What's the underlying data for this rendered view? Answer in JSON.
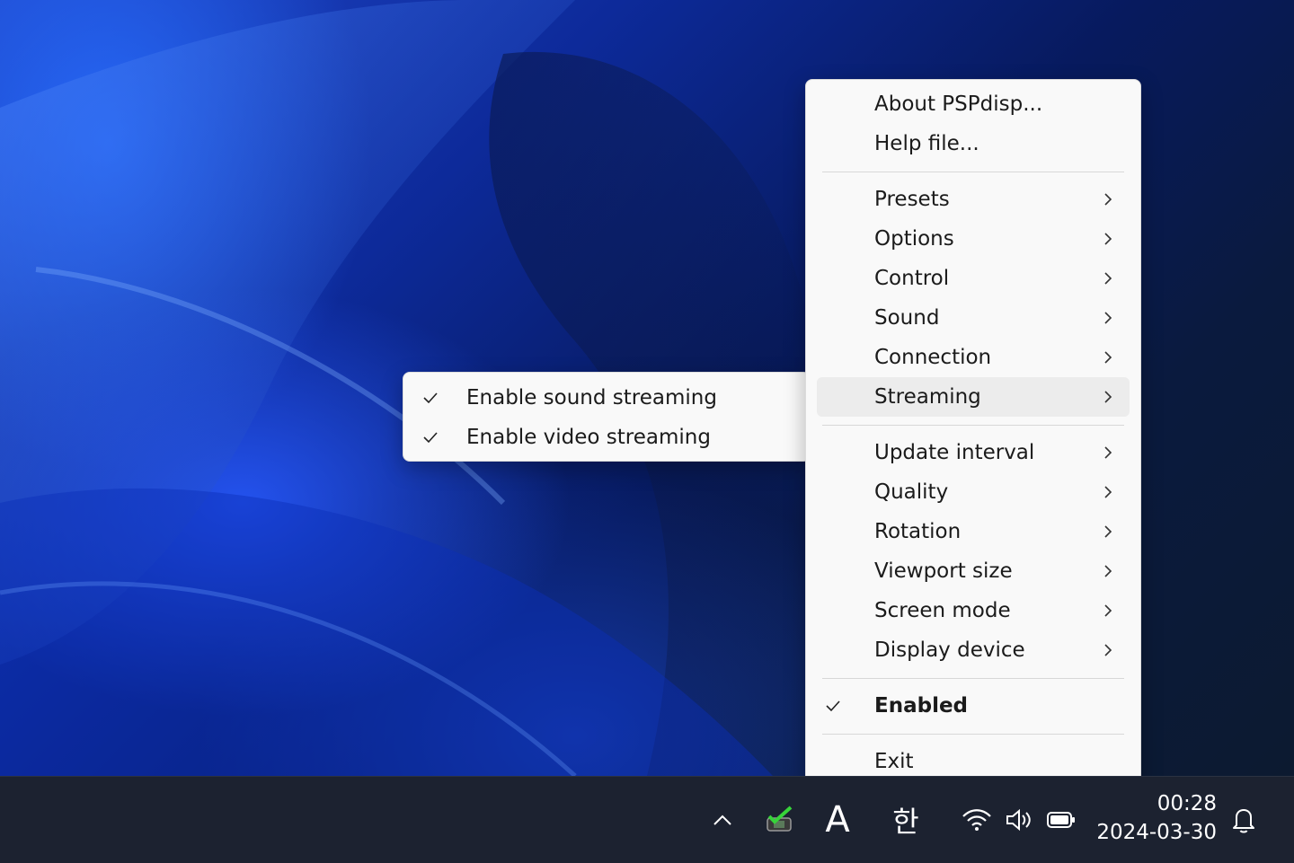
{
  "main_menu": {
    "group1": [
      "About PSPdisp...",
      "Help file..."
    ],
    "group2": [
      "Presets",
      "Options",
      "Control",
      "Sound",
      "Connection",
      "Streaming"
    ],
    "group3": [
      "Update interval",
      "Quality",
      "Rotation",
      "Viewport size",
      "Screen mode",
      "Display device"
    ],
    "enabled": "Enabled",
    "exit": "Exit",
    "highlighted": "Streaming"
  },
  "sub_menu": {
    "items": [
      "Enable sound streaming",
      "Enable video streaming"
    ],
    "checked": [
      true,
      true
    ]
  },
  "taskbar": {
    "ime_latin": "A",
    "ime_hangul": "한",
    "time": "00:28",
    "date": "2024-03-30",
    "icons": [
      "chevron-up-icon",
      "pspdisp-tray-icon",
      "wifi-icon",
      "speaker-icon",
      "battery-icon",
      "bell-icon"
    ]
  },
  "colors": {
    "menu_bg": "#f9f9f9",
    "hover_bg": "#ececec",
    "taskbar_bg": "#1c2230",
    "wallpaper_accent": "#1f46c9"
  }
}
